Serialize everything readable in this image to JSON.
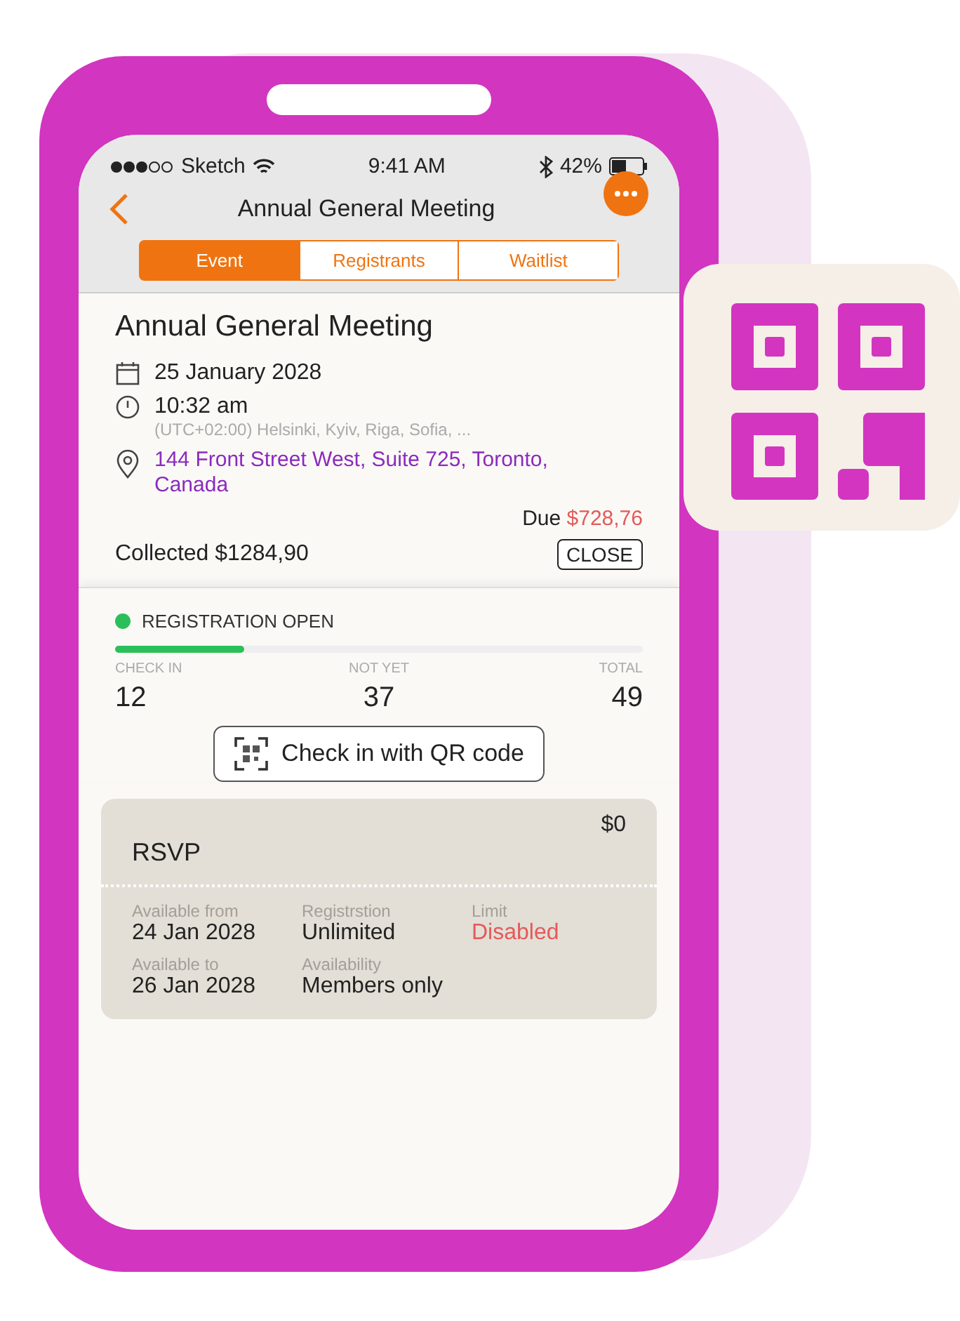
{
  "status_bar": {
    "carrier": "Sketch",
    "time": "9:41 AM",
    "battery": "42%"
  },
  "nav": {
    "title": "Annual General Meeting"
  },
  "tabs": [
    {
      "label": "Event",
      "selected": true
    },
    {
      "label": "Registrants",
      "selected": false
    },
    {
      "label": "Waitlist",
      "selected": false
    }
  ],
  "event": {
    "title": "Annual General Meeting",
    "date": "25 January 2028",
    "time": "10:32 am",
    "timezone": "(UTC+02:00) Helsinki, Kyiv, Riga, Sofia, ...",
    "address": "144 Front Street West, Suite 725, Toronto, Canada",
    "due_label": "Due",
    "due_amount": "$728,76",
    "collected": "Collected $1284,90",
    "close_button": "CLOSE"
  },
  "registration": {
    "status": "REGISTRATION OPEN",
    "open": true,
    "level": 0.245,
    "stats": [
      {
        "label": "CHECK IN",
        "value": "12"
      },
      {
        "label": "NOT YET",
        "value": "37"
      },
      {
        "label": "TOTAL",
        "value": "49"
      }
    ],
    "qr_button": "Check in with QR code"
  },
  "ticket": {
    "price": "$0",
    "name": "RSVP",
    "fields": [
      {
        "label": "Available from",
        "value": "24 Jan 2028",
        "warning": false
      },
      {
        "label": "Registrstion",
        "value": "Unlimited",
        "warning": false
      },
      {
        "label": "Limit",
        "value": "Disabled",
        "warning": true
      },
      {
        "label": "Available to",
        "value": "26 Jan 2028",
        "warning": false
      },
      {
        "label": "Availability",
        "value": "Members only",
        "warning": false
      }
    ]
  }
}
